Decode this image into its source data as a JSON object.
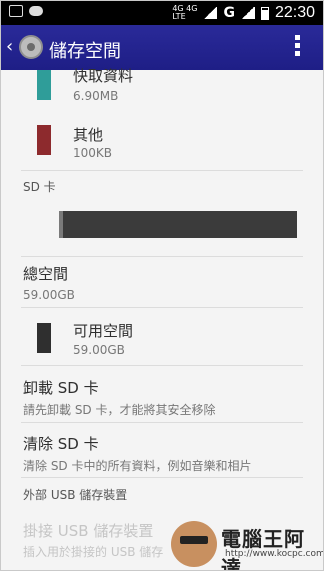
{
  "status_bar": {
    "network_top": "4G 4G",
    "network_bottom": "LTE",
    "signal_g": "G",
    "time": "22:30"
  },
  "action_bar": {
    "title": "儲存空間",
    "icons": [
      "back-arrow-icon",
      "settings-app-icon",
      "overflow-menu-icon"
    ]
  },
  "content": {
    "cached_data": {
      "label": "快取資料",
      "size": "6.90MB",
      "color": "#2f9d99"
    },
    "other": {
      "label": "其他",
      "size": "100KB",
      "color": "#8d2a2d"
    },
    "sd_section": "SD 卡",
    "sd_bar": {
      "used_color": "#7a7a7a",
      "remaining_color": "#3b3b3b"
    },
    "total_space": {
      "label": "總空間",
      "value": "59.00GB"
    },
    "available_space": {
      "label": "可用空間",
      "value": "59.00GB",
      "color": "#2f2f2f"
    },
    "unmount_sd": {
      "label": "卸載 SD 卡",
      "desc": "請先卸載 SD 卡，才能將其安全移除"
    },
    "erase_sd": {
      "label": "清除 SD 卡",
      "desc": "清除 SD 卡中的所有資料，例如音樂和相片"
    },
    "usb_section": "外部 USB 儲存裝置",
    "mount_usb": {
      "label": "掛接 USB 儲存裝置",
      "desc": "插入用於掛接的 USB 儲存"
    }
  },
  "watermark": {
    "title": "電腦王阿達",
    "url": "http://www.kocpc.com.tw"
  }
}
